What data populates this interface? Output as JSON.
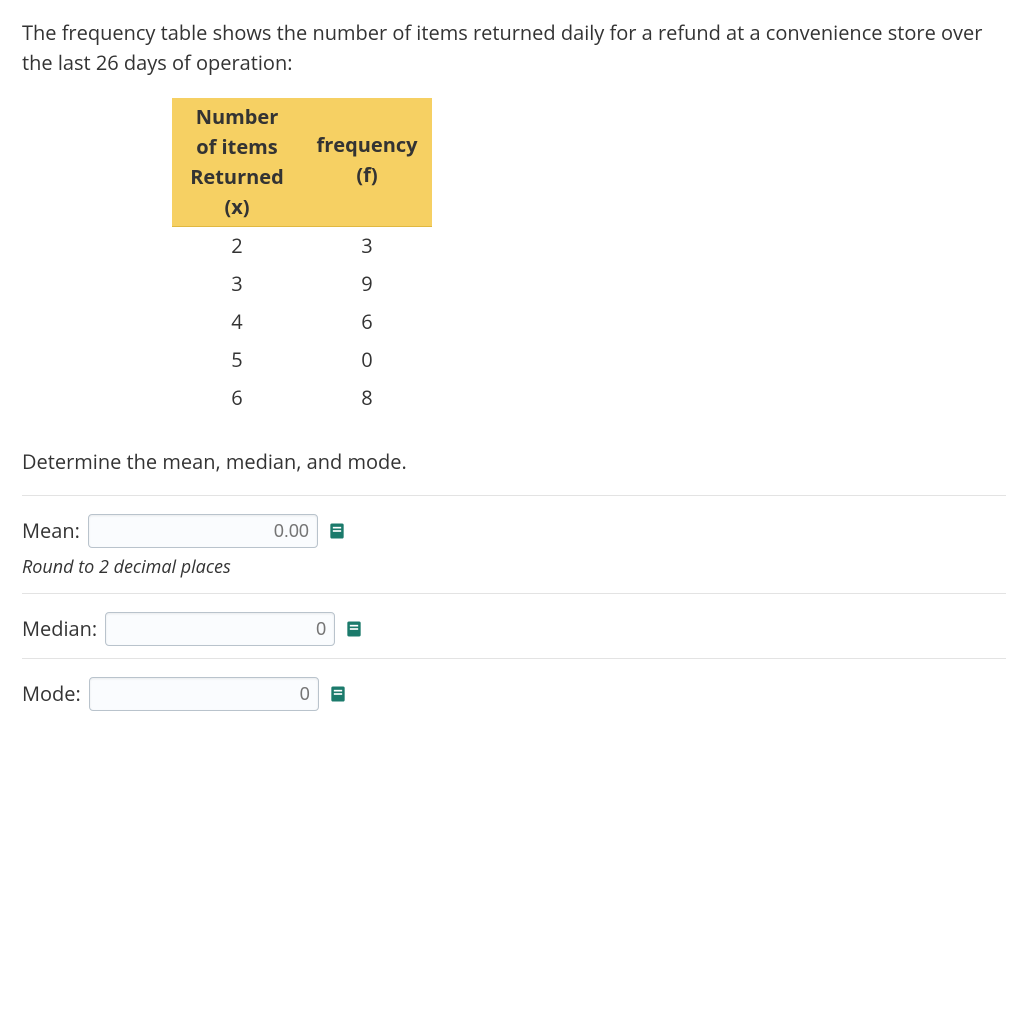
{
  "question": {
    "intro": "The frequency table shows the number of items returned daily for a refund at a convenience store over the last 26 days of operation:",
    "prompt": "Determine the mean, median, and mode."
  },
  "table": {
    "header_x_l1": "Number",
    "header_x_l2": "of items",
    "header_x_l3": "Returned",
    "header_x_l4": "(x)",
    "header_f_l1": "frequency",
    "header_f_l2": "(f)",
    "rows": [
      {
        "x": "2",
        "f": "3"
      },
      {
        "x": "3",
        "f": "9"
      },
      {
        "x": "4",
        "f": "6"
      },
      {
        "x": "5",
        "f": "0"
      },
      {
        "x": "6",
        "f": "8"
      }
    ]
  },
  "answers": {
    "mean_label": "Mean:",
    "mean_placeholder": "0.00",
    "mean_hint": "Round to 2 decimal places",
    "median_label": "Median:",
    "median_placeholder": "0",
    "mode_label": "Mode:",
    "mode_placeholder": "0"
  },
  "chart_data": {
    "type": "table",
    "title": "Frequency of items returned daily over 26 days",
    "columns": [
      "Number of items Returned (x)",
      "frequency (f)"
    ],
    "rows": [
      [
        2,
        3
      ],
      [
        3,
        9
      ],
      [
        4,
        6
      ],
      [
        5,
        0
      ],
      [
        6,
        8
      ]
    ]
  }
}
